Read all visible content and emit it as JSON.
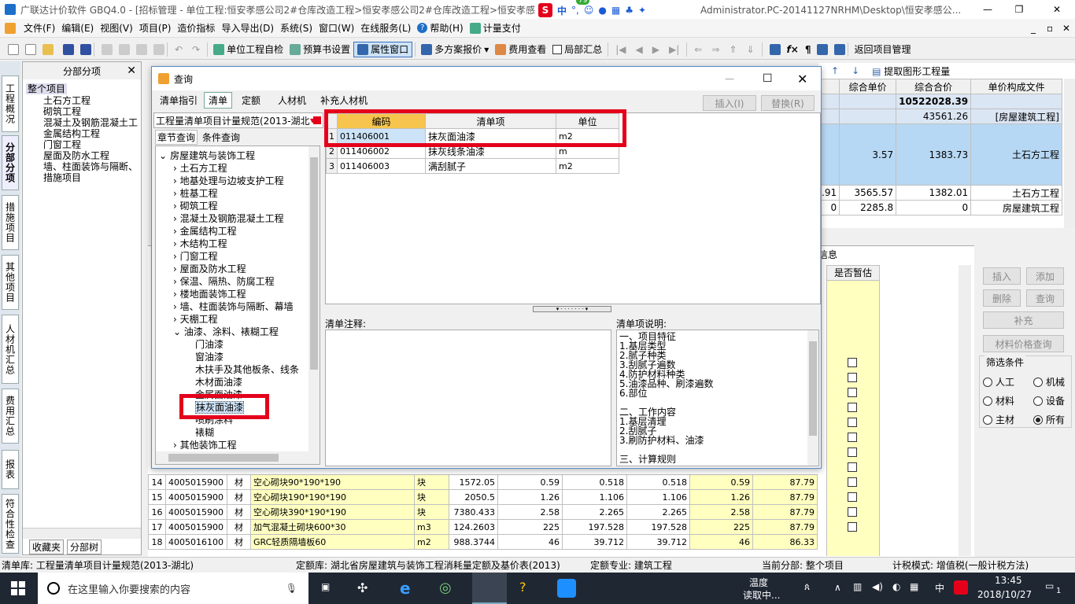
{
  "title_bar": {
    "text": "广联达计价软件 GBQ4.0 - [招标管理 - 单位工程:恒安孝感公司2#仓库改造工程>恒安孝感公司2#仓库改造工程>恒安孝感公司2#仓库改造工程"
  },
  "title_bar_right": {
    "text": "Administrator.PC-20141127NRHM\\Desktop\\恒安孝感公..."
  },
  "ime": {
    "label": "中",
    "badge": "79"
  },
  "menu": [
    "文件(F)",
    "编辑(E)",
    "视图(V)",
    "项目(P)",
    "造价指标",
    "导入导出(D)",
    "系统(S)",
    "窗口(W)",
    "在线服务(L)",
    "帮助(H)",
    "计量支付"
  ],
  "toolbar": {
    "self_check": "单位工程自检",
    "budget_setting": "预算书设置",
    "attr_window": "属性窗口",
    "multi_quote": "多方案报价",
    "fee_view": "费用查看",
    "partial_sum": "局部汇总",
    "return_pm": "返回项目管理",
    "extract": "提取图形工程量"
  },
  "left_tabs": [
    "工程概况",
    "分部分项",
    "措施项目",
    "其他项目",
    "人材机汇总",
    "费用汇总",
    "报表",
    "符合性检查"
  ],
  "left_panel": {
    "title": "分部分项",
    "root": "整个项目",
    "items": [
      "土石方工程",
      "砌筑工程",
      "混凝土及钢筋混凝土工",
      "金属结构工程",
      "门窗工程",
      "屋面及防水工程",
      "墙、柱面装饰与隔断、",
      "措施项目"
    ],
    "tabs": [
      "收藏夹",
      "分部树"
    ]
  },
  "bg_top": {
    "headers": [
      "综合单价",
      "综合合价",
      "单价构成文件"
    ],
    "rows": [
      [
        "",
        "10522028.39",
        ""
      ],
      [
        "",
        "43561.26",
        "[房屋建筑工程]"
      ],
      [
        "3.57",
        "1383.73",
        "土石方工程"
      ],
      [
        "3565.57",
        "1382.01",
        "土石方工程"
      ],
      [
        "2285.8",
        "0",
        "房屋建筑工程"
      ]
    ],
    "partial": [
      ".91",
      "0"
    ]
  },
  "bg_info": {
    "label": "信息",
    "col": "是否暂估"
  },
  "bg_rows": [
    [
      "14",
      "4005015900",
      "材",
      "空心砌块90*190*190",
      "块",
      "1572.05",
      "0.59",
      "0.518",
      "0.518",
      "0.59",
      "87.79"
    ],
    [
      "15",
      "4005015900",
      "材",
      "空心砌块190*190*190",
      "块",
      "2050.5",
      "1.26",
      "1.106",
      "1.106",
      "1.26",
      "87.79"
    ],
    [
      "16",
      "4005015900",
      "材",
      "空心砌块390*190*190",
      "块",
      "7380.433",
      "2.58",
      "2.265",
      "2.265",
      "2.58",
      "87.79"
    ],
    [
      "17",
      "4005015900",
      "材",
      "加气混凝土砌块600*30",
      "m3",
      "124.2603",
      "225",
      "197.528",
      "197.528",
      "225",
      "87.79"
    ],
    [
      "18",
      "4005016100",
      "材",
      "GRC轻质隔墙板60",
      "m2",
      "988.3744",
      "46",
      "39.712",
      "39.712",
      "46",
      "86.33"
    ]
  ],
  "right_panel": {
    "insert": "插入",
    "add": "添加",
    "delete": "删除",
    "query": "查询",
    "supplement": "补充",
    "price_query": "材料价格查询",
    "filter_title": "筛选条件",
    "options": [
      "人工",
      "机械",
      "材料",
      "设备",
      "主材",
      "所有"
    ],
    "selected": "所有"
  },
  "dialog": {
    "title": "查询",
    "tabs": [
      "清单指引",
      "清单",
      "定额",
      "人材机",
      "补充人材机"
    ],
    "active_tab": "清单",
    "insert": "插入(I)",
    "replace": "替换(R)",
    "spec": "工程量清单项目计量规范(2013-湖北)",
    "subtabs": [
      "章节查询",
      "条件查询"
    ],
    "tree": {
      "root": "房屋建筑与装饰工程",
      "chapters": [
        "土石方工程",
        "地基处理与边坡支护工程",
        "桩基工程",
        "砌筑工程",
        "混凝土及钢筋混凝土工程",
        "金属结构工程",
        "木结构工程",
        "门窗工程",
        "屋面及防水工程",
        "保温、隔热、防腐工程",
        "楼地面装饰工程",
        "墙、柱面装饰与隔断、幕墙",
        "天棚工程",
        "油漆、涂料、裱糊工程"
      ],
      "sub": [
        "门油漆",
        "窗油漆",
        "木扶手及其他板条、线条",
        "木材面油漆",
        "金属面油漆",
        "抹灰面油漆",
        "喷刷涂料",
        "裱糊"
      ],
      "last": "其他装饰工程"
    },
    "table": {
      "headers": [
        "编码",
        "清单项",
        "单位"
      ],
      "rows": [
        [
          "1",
          "011406001",
          "抹灰面油漆",
          "m2"
        ],
        [
          "2",
          "011406002",
          "抹灰线条油漆",
          "m"
        ],
        [
          "3",
          "011406003",
          "满刮腻子",
          "m2"
        ]
      ]
    },
    "note_label": "清单注释:",
    "desc_label": "清单项说明:",
    "desc_lines": [
      "一、项目特征",
      "1.基层类型",
      "2.腻子种类",
      "3.刮腻子遍数",
      "4.防护材料种类",
      "5.油漆品种、刷漆遍数",
      "6.部位",
      "",
      "二、工作内容",
      "1.基层清理",
      "2.刮腻子",
      "3.刷防护材料、油漆",
      "",
      "三、计算规则"
    ]
  },
  "status": [
    "清单库: 工程量清单项目计量规范(2013-湖北)",
    "定额库: 湖北省房屋建筑与装饰工程消耗量定额及基价表(2013)",
    "定额专业: 建筑工程",
    "当前分部: 整个项目",
    "计税模式: 增值税(一般计税方法)"
  ],
  "taskbar": {
    "search": "在这里输入你要搜索的内容",
    "weather1": "温度",
    "weather2": "读取中...",
    "ime": "中",
    "time": "13:45",
    "date": "2018/10/27",
    "notify": "1"
  },
  "colors": {
    "highlight_red": "#e4001b",
    "title_bg": "#ffffff",
    "yellow_cell": "#ffffc0",
    "blue_sel": "#cde3f7"
  }
}
